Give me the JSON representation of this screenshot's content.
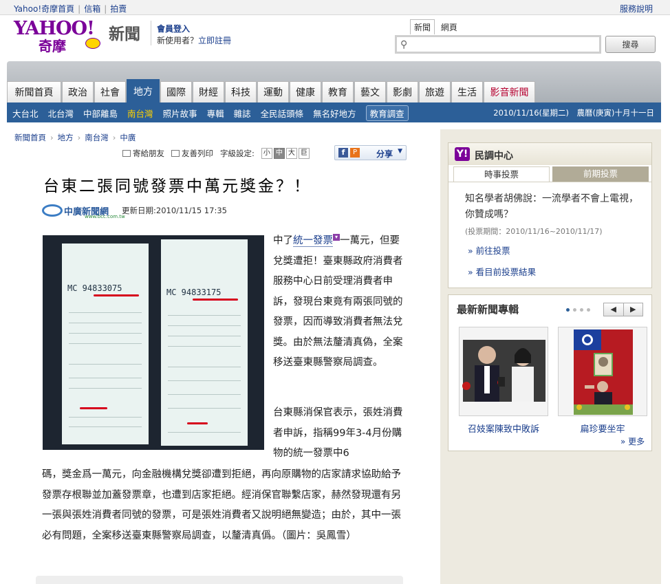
{
  "topbar": {
    "links": [
      "Yahoo!奇摩首頁",
      "信箱",
      "拍賣"
    ],
    "help": "服務說明"
  },
  "header": {
    "logo_text": "YAHOO!",
    "logo_sub": "奇摩",
    "channel": "新聞",
    "login": "會員登入",
    "new_user_prefix": "新使用者？",
    "register": "立即註冊"
  },
  "search": {
    "tabs": [
      "新聞",
      "網頁"
    ],
    "active_tab": "新聞",
    "value": "",
    "button": "搜尋"
  },
  "nav": {
    "tabs": [
      "新聞首頁",
      "政治",
      "社會",
      "地方",
      "國際",
      "財經",
      "科技",
      "運動",
      "健康",
      "教育",
      "藝文",
      "影劇",
      "旅遊",
      "生活",
      "影音新聞"
    ],
    "active": "地方",
    "sub": [
      "大台北",
      "北台灣",
      "中部離島",
      "南台灣",
      "照片故事",
      "專輯",
      "雜誌",
      "全民話頭條",
      "無名好地方",
      "教育調查"
    ],
    "sub_active": "南台灣",
    "date": "2010/11/16(星期二)　農曆(庚寅)十月十一日"
  },
  "breadcrumb": [
    "新聞首頁",
    "地方",
    "南台灣",
    "中廣"
  ],
  "tools": {
    "email": "寄給朋友",
    "print": "友善列印",
    "font_label": "字級設定:",
    "font_sizes": [
      "小",
      "中",
      "大",
      "巨"
    ],
    "share": "分享"
  },
  "article": {
    "title": "台東二張同號發票中萬元獎金？！",
    "source": "中廣新聞網",
    "source_sub": "www.bcc.com.tw",
    "updated": "更新日期:2010/11/15 17:35",
    "p1_prefix": "中了",
    "p1_link": "統一發票",
    "p1_rest": "一萬元，但要兌獎遭拒！臺東縣政府消費者服務中心日前受理消費者申訴，發現台東竟有兩張同號的發票，因而導致消費者無法兌獎。由於無法釐清真偽，全案移送臺東縣警察局調查。",
    "p2_a": "台東縣消保官表示，張姓消費者申訴，指稱99年3-4月份購物的統一發票中6",
    "p2_b": "碼，獎金爲一萬元，向金融機構兌獎卻遭到拒絕，再向原購物的店家請求協助給予發票存根聯並加蓋發票章，也遭到店家拒絕。經消保官聯繫店家，赫然發現還有另一張與張姓消費者同號的發票，可是張姓消費者又說明絕無變造；由於，其中一張必有問題，全案移送臺東縣警察局調查，以釐清真僞。（圖片：吳鳳雪）",
    "receipt_numbers": [
      "MC 94833075",
      "MC 94833175"
    ]
  },
  "poll": {
    "title": "民調中心",
    "tabs": [
      "時事投票",
      "前期投票"
    ],
    "question": "知名學者胡佛說：一流學者不會上電視，你贊成嗎？",
    "period": "(投票期間：2010/11/16~2010/11/17)",
    "vote_link": "» 前往投票",
    "result_link": "» 看目前投票結果"
  },
  "features": {
    "title": "最新新聞專輯",
    "items": [
      "召妓案陳致中敗訴",
      "扁珍要坐牢"
    ],
    "more": "» 更多"
  }
}
